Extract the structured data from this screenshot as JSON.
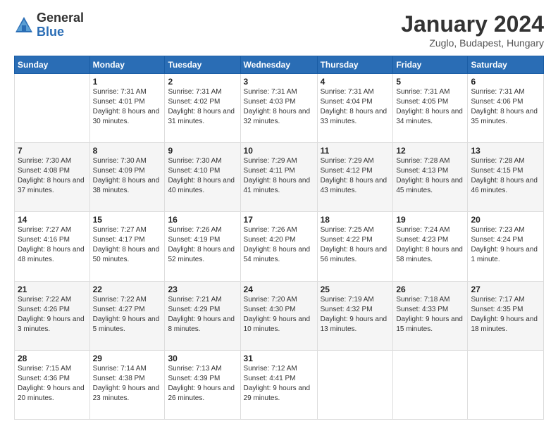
{
  "logo": {
    "general": "General",
    "blue": "Blue"
  },
  "title": "January 2024",
  "subtitle": "Zuglo, Budapest, Hungary",
  "columns": [
    "Sunday",
    "Monday",
    "Tuesday",
    "Wednesday",
    "Thursday",
    "Friday",
    "Saturday"
  ],
  "weeks": [
    [
      {
        "day": "",
        "sunrise": "",
        "sunset": "",
        "daylight": ""
      },
      {
        "day": "1",
        "sunrise": "Sunrise: 7:31 AM",
        "sunset": "Sunset: 4:01 PM",
        "daylight": "Daylight: 8 hours and 30 minutes."
      },
      {
        "day": "2",
        "sunrise": "Sunrise: 7:31 AM",
        "sunset": "Sunset: 4:02 PM",
        "daylight": "Daylight: 8 hours and 31 minutes."
      },
      {
        "day": "3",
        "sunrise": "Sunrise: 7:31 AM",
        "sunset": "Sunset: 4:03 PM",
        "daylight": "Daylight: 8 hours and 32 minutes."
      },
      {
        "day": "4",
        "sunrise": "Sunrise: 7:31 AM",
        "sunset": "Sunset: 4:04 PM",
        "daylight": "Daylight: 8 hours and 33 minutes."
      },
      {
        "day": "5",
        "sunrise": "Sunrise: 7:31 AM",
        "sunset": "Sunset: 4:05 PM",
        "daylight": "Daylight: 8 hours and 34 minutes."
      },
      {
        "day": "6",
        "sunrise": "Sunrise: 7:31 AM",
        "sunset": "Sunset: 4:06 PM",
        "daylight": "Daylight: 8 hours and 35 minutes."
      }
    ],
    [
      {
        "day": "7",
        "sunrise": "Sunrise: 7:30 AM",
        "sunset": "Sunset: 4:08 PM",
        "daylight": "Daylight: 8 hours and 37 minutes."
      },
      {
        "day": "8",
        "sunrise": "Sunrise: 7:30 AM",
        "sunset": "Sunset: 4:09 PM",
        "daylight": "Daylight: 8 hours and 38 minutes."
      },
      {
        "day": "9",
        "sunrise": "Sunrise: 7:30 AM",
        "sunset": "Sunset: 4:10 PM",
        "daylight": "Daylight: 8 hours and 40 minutes."
      },
      {
        "day": "10",
        "sunrise": "Sunrise: 7:29 AM",
        "sunset": "Sunset: 4:11 PM",
        "daylight": "Daylight: 8 hours and 41 minutes."
      },
      {
        "day": "11",
        "sunrise": "Sunrise: 7:29 AM",
        "sunset": "Sunset: 4:12 PM",
        "daylight": "Daylight: 8 hours and 43 minutes."
      },
      {
        "day": "12",
        "sunrise": "Sunrise: 7:28 AM",
        "sunset": "Sunset: 4:13 PM",
        "daylight": "Daylight: 8 hours and 45 minutes."
      },
      {
        "day": "13",
        "sunrise": "Sunrise: 7:28 AM",
        "sunset": "Sunset: 4:15 PM",
        "daylight": "Daylight: 8 hours and 46 minutes."
      }
    ],
    [
      {
        "day": "14",
        "sunrise": "Sunrise: 7:27 AM",
        "sunset": "Sunset: 4:16 PM",
        "daylight": "Daylight: 8 hours and 48 minutes."
      },
      {
        "day": "15",
        "sunrise": "Sunrise: 7:27 AM",
        "sunset": "Sunset: 4:17 PM",
        "daylight": "Daylight: 8 hours and 50 minutes."
      },
      {
        "day": "16",
        "sunrise": "Sunrise: 7:26 AM",
        "sunset": "Sunset: 4:19 PM",
        "daylight": "Daylight: 8 hours and 52 minutes."
      },
      {
        "day": "17",
        "sunrise": "Sunrise: 7:26 AM",
        "sunset": "Sunset: 4:20 PM",
        "daylight": "Daylight: 8 hours and 54 minutes."
      },
      {
        "day": "18",
        "sunrise": "Sunrise: 7:25 AM",
        "sunset": "Sunset: 4:22 PM",
        "daylight": "Daylight: 8 hours and 56 minutes."
      },
      {
        "day": "19",
        "sunrise": "Sunrise: 7:24 AM",
        "sunset": "Sunset: 4:23 PM",
        "daylight": "Daylight: 8 hours and 58 minutes."
      },
      {
        "day": "20",
        "sunrise": "Sunrise: 7:23 AM",
        "sunset": "Sunset: 4:24 PM",
        "daylight": "Daylight: 9 hours and 1 minute."
      }
    ],
    [
      {
        "day": "21",
        "sunrise": "Sunrise: 7:22 AM",
        "sunset": "Sunset: 4:26 PM",
        "daylight": "Daylight: 9 hours and 3 minutes."
      },
      {
        "day": "22",
        "sunrise": "Sunrise: 7:22 AM",
        "sunset": "Sunset: 4:27 PM",
        "daylight": "Daylight: 9 hours and 5 minutes."
      },
      {
        "day": "23",
        "sunrise": "Sunrise: 7:21 AM",
        "sunset": "Sunset: 4:29 PM",
        "daylight": "Daylight: 9 hours and 8 minutes."
      },
      {
        "day": "24",
        "sunrise": "Sunrise: 7:20 AM",
        "sunset": "Sunset: 4:30 PM",
        "daylight": "Daylight: 9 hours and 10 minutes."
      },
      {
        "day": "25",
        "sunrise": "Sunrise: 7:19 AM",
        "sunset": "Sunset: 4:32 PM",
        "daylight": "Daylight: 9 hours and 13 minutes."
      },
      {
        "day": "26",
        "sunrise": "Sunrise: 7:18 AM",
        "sunset": "Sunset: 4:33 PM",
        "daylight": "Daylight: 9 hours and 15 minutes."
      },
      {
        "day": "27",
        "sunrise": "Sunrise: 7:17 AM",
        "sunset": "Sunset: 4:35 PM",
        "daylight": "Daylight: 9 hours and 18 minutes."
      }
    ],
    [
      {
        "day": "28",
        "sunrise": "Sunrise: 7:15 AM",
        "sunset": "Sunset: 4:36 PM",
        "daylight": "Daylight: 9 hours and 20 minutes."
      },
      {
        "day": "29",
        "sunrise": "Sunrise: 7:14 AM",
        "sunset": "Sunset: 4:38 PM",
        "daylight": "Daylight: 9 hours and 23 minutes."
      },
      {
        "day": "30",
        "sunrise": "Sunrise: 7:13 AM",
        "sunset": "Sunset: 4:39 PM",
        "daylight": "Daylight: 9 hours and 26 minutes."
      },
      {
        "day": "31",
        "sunrise": "Sunrise: 7:12 AM",
        "sunset": "Sunset: 4:41 PM",
        "daylight": "Daylight: 9 hours and 29 minutes."
      },
      {
        "day": "",
        "sunrise": "",
        "sunset": "",
        "daylight": ""
      },
      {
        "day": "",
        "sunrise": "",
        "sunset": "",
        "daylight": ""
      },
      {
        "day": "",
        "sunrise": "",
        "sunset": "",
        "daylight": ""
      }
    ]
  ]
}
